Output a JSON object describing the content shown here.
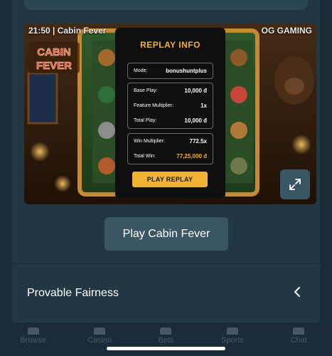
{
  "game": {
    "header": "21:50 | Cabin Fever",
    "provider": "OG GAMING",
    "logo_text_1": "CABIN",
    "logo_text_2": "FEVER"
  },
  "replay_modal": {
    "title": "REPLAY INFO",
    "mode_label": "Mode:",
    "mode_value": "bonushuntplus",
    "base_play_label": "Base Play:",
    "base_play_value": "10,000 đ",
    "feature_multiplier_label": "Feature Multiplier:",
    "feature_multiplier_value": "1x",
    "total_play_label": "Total Play:",
    "total_play_value": "10,000 đ",
    "win_multiplier_label": "Win Multiplier:",
    "win_multiplier_value": "772.5x",
    "total_win_label": "Total Win:",
    "total_win_value": "77,25,000 đ",
    "button_label": "PLAY REPLAY"
  },
  "actions": {
    "play_button": "Play Cabin Fever",
    "expand_icon": "expand-icon"
  },
  "fairness": {
    "title": "Provable Fairness",
    "chevron_icon": "chevron-left-icon"
  },
  "nav": {
    "items": [
      "Browse",
      "Casino",
      "Bets",
      "Sports",
      "Chat"
    ]
  },
  "colors": {
    "background": "#1a2c38",
    "panel": "#213743",
    "button": "#3a5563",
    "gold": "#f2b233"
  }
}
